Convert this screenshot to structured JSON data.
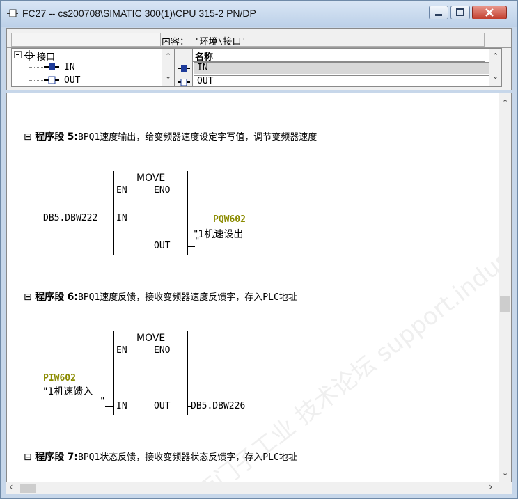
{
  "window": {
    "title": "FC27 -- cs200708\\SIMATIC 300(1)\\CPU 315-2 PN/DP",
    "icon": "block-icon"
  },
  "interface": {
    "content_label": "内容：  '环境\\接口'",
    "tree": [
      {
        "label": "接口",
        "icon": "interface-icon"
      },
      {
        "label": "IN",
        "icon": "in-icon"
      },
      {
        "label": "OUT",
        "icon": "out-icon"
      }
    ],
    "grid_header": "名称",
    "grid_rows": [
      "IN",
      "OUT"
    ]
  },
  "networks": [
    {
      "prefix": "程序段",
      "number": "5",
      "comment": "BPQ1速度输出，给变频器速度设定字写值，调节变频器速度",
      "box_title": "MOVE",
      "en": "EN",
      "eno": "ENO",
      "in": "IN",
      "out": "OUT",
      "in_operand": "DB5.DBW222",
      "out_address": "PQW602",
      "out_symbol": "\"1机速设出",
      "out_symbol_end": "\""
    },
    {
      "prefix": "程序段",
      "number": "6",
      "comment": "BPQ1速度反馈，接收变频器速度反馈字，存入PLC地址",
      "box_title": "MOVE",
      "en": "EN",
      "eno": "ENO",
      "in": "IN",
      "out": "OUT",
      "in_address": "PIW602",
      "in_symbol": "\"1机速馈入",
      "in_symbol_end": "\"",
      "out_operand": "DB5.DBW226"
    },
    {
      "prefix": "程序段",
      "number": "7",
      "comment": "BPQ1状态反馈，接收变频器状态反馈字，存入PLC地址"
    }
  ],
  "watermark": "西门子工业 技术论坛 support.industry.siemens.com/cs",
  "colors": {
    "address": "#8b8b00",
    "title_bar_top": "#d9e6f5",
    "title_bar_bottom": "#bcd0e8",
    "close_button": "#c23f2e"
  }
}
